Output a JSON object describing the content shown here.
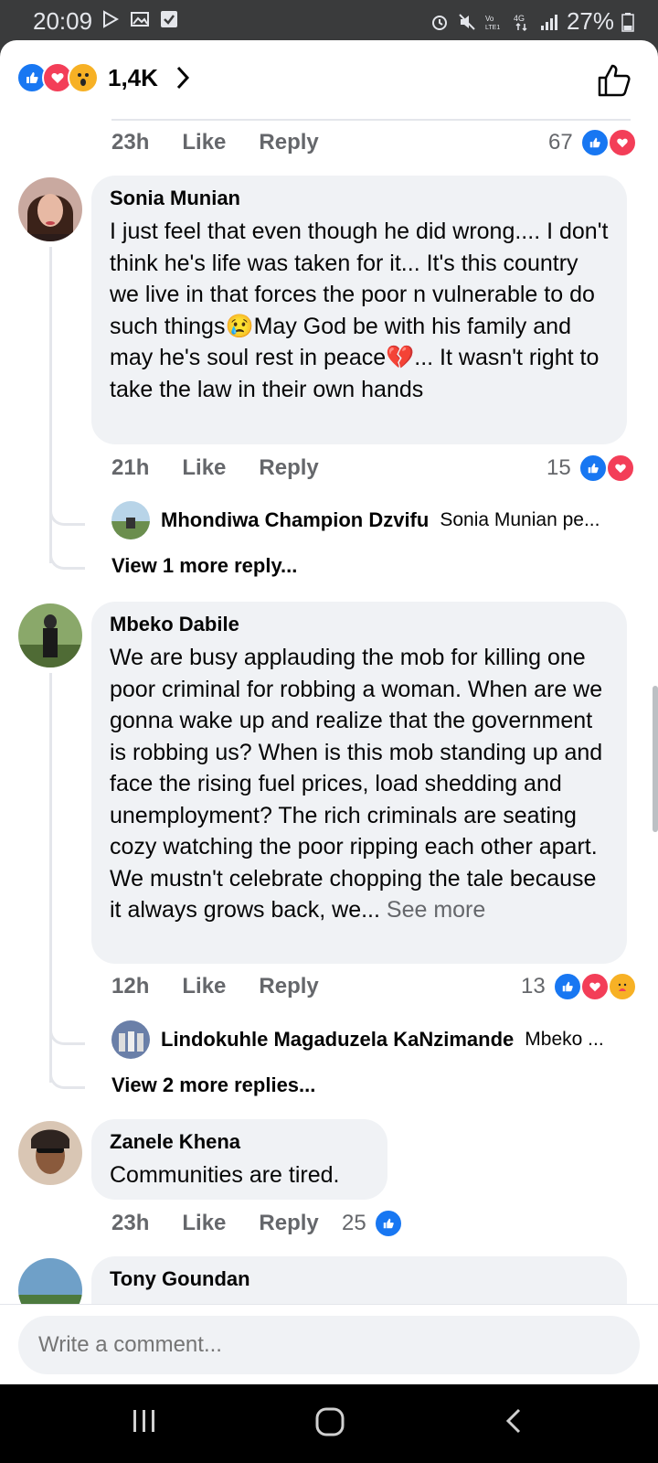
{
  "status_bar": {
    "time": "20:09",
    "battery": "27%"
  },
  "header": {
    "reaction_count": "1,4K"
  },
  "comments": [
    {
      "time": "23h",
      "like": "Like",
      "reply": "Reply",
      "reaction_count": "67"
    },
    {
      "author": "Sonia Munian",
      "text": "I just feel that even though he did wrong.... I don't think he's life was taken for it... It's this country we live in that forces the poor n vulnerable to do such things😢May God  be with his family and may he's soul rest in peace💔... It wasn't right to take the law in their own hands",
      "time": "21h",
      "like": "Like",
      "reply": "Reply",
      "reaction_count": "15",
      "reply_preview": {
        "author": "Mhondiwa Champion Dzvifu",
        "text": "Sonia Munian pe..."
      },
      "view_more": "View 1 more reply..."
    },
    {
      "author": "Mbeko Dabile",
      "text": "We are busy applauding the mob for killing one poor criminal for robbing a woman. When are we gonna wake up and realize that the government is robbing us? When is this mob standing up and face the rising fuel prices, load shedding and unemployment? The rich criminals are seating cozy watching the poor ripping each other apart. We mustn't celebrate chopping the tale because it always grows back, we...",
      "see_more": "See more",
      "time": "12h",
      "like": "Like",
      "reply": "Reply",
      "reaction_count": "13",
      "reply_preview": {
        "author": "Lindokuhle Magaduzela KaNzimande",
        "text": "Mbeko ..."
      },
      "view_more": "View 2 more replies..."
    },
    {
      "author": "Zanele Khena",
      "text": "Communities are tired.",
      "time": "23h",
      "like": "Like",
      "reply": "Reply",
      "reaction_count": "25"
    },
    {
      "author": "Tony Goundan"
    }
  ],
  "composer": {
    "placeholder": "Write a comment..."
  },
  "icons": [
    "like-icon",
    "love-icon",
    "wow-icon",
    "care-icon",
    "chevron-right-icon",
    "thumbs-up-outline-icon",
    "recents-icon",
    "home-icon",
    "back-icon"
  ]
}
